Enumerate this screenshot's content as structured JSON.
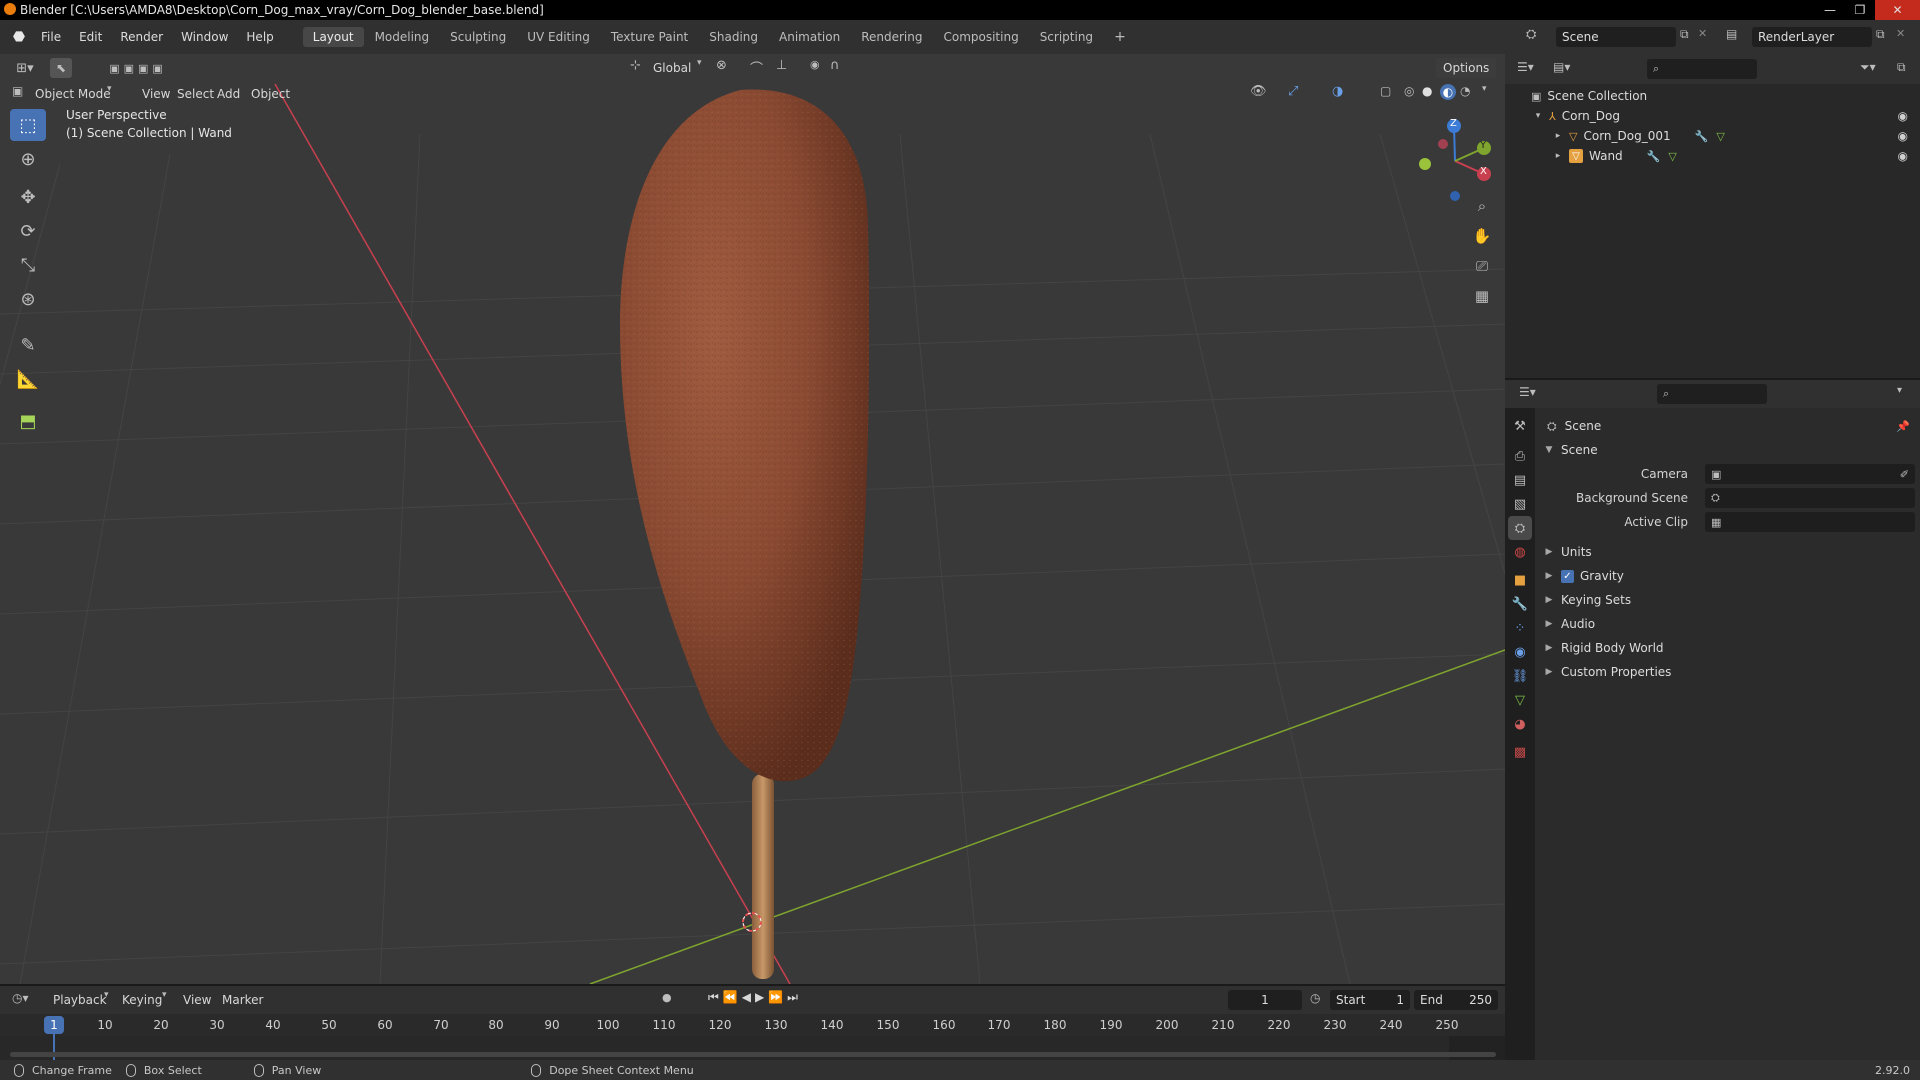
{
  "window": {
    "title": "Blender [C:\\Users\\AMDA8\\Desktop\\Corn_Dog_max_vray/Corn_Dog_blender_base.blend]",
    "controls": {
      "minimize": "—",
      "maximize": "❐",
      "close": "✕"
    }
  },
  "menu": {
    "items": [
      "File",
      "Edit",
      "Render",
      "Window",
      "Help"
    ],
    "workspaces": [
      "Layout",
      "Modeling",
      "Sculpting",
      "UV Editing",
      "Texture Paint",
      "Shading",
      "Animation",
      "Rendering",
      "Compositing",
      "Scripting"
    ],
    "active_workspace": "Layout",
    "add_workspace": "+",
    "scene": "Scene",
    "view_layer": "RenderLayer"
  },
  "viewport": {
    "mode": "Object Mode",
    "menus": [
      "View",
      "Select",
      "Add",
      "Object"
    ],
    "transform_orientation": "Global",
    "options_label": "Options",
    "overlay_title": "User Perspective",
    "overlay_subtitle": "(1) Scene Collection | Wand",
    "gizmo_labels": {
      "x": "X",
      "y": "Y",
      "z": "Z"
    },
    "tools": [
      "select-box",
      "cursor",
      "move",
      "rotate",
      "scale",
      "transform",
      "annotate",
      "measure",
      "add-cube"
    ],
    "active_tool": "select-box"
  },
  "outliner": {
    "root": "Scene Collection",
    "items": [
      {
        "label": "Corn_Dog",
        "depth": 1,
        "expanded": true
      },
      {
        "label": "Corn_Dog_001",
        "depth": 2,
        "expanded": false
      },
      {
        "label": "Wand",
        "depth": 2,
        "expanded": false
      }
    ]
  },
  "properties": {
    "context": "Scene",
    "panel_title": "Scene",
    "fields": [
      {
        "label": "Camera",
        "value": ""
      },
      {
        "label": "Background Scene",
        "value": ""
      },
      {
        "label": "Active Clip",
        "value": ""
      }
    ],
    "subpanels": [
      {
        "label": "Units",
        "checkbox": false
      },
      {
        "label": "Gravity",
        "checkbox": true,
        "checked": true
      },
      {
        "label": "Keying Sets",
        "checkbox": false
      },
      {
        "label": "Audio",
        "checkbox": false
      },
      {
        "label": "Rigid Body World",
        "checkbox": false
      },
      {
        "label": "Custom Properties",
        "checkbox": false
      }
    ]
  },
  "timeline": {
    "menus": [
      "Playback",
      "Keying",
      "View",
      "Marker"
    ],
    "current_frame": "1",
    "start_label": "Start",
    "start_value": "1",
    "end_label": "End",
    "end_value": "250",
    "ticks": [
      "1",
      "10",
      "20",
      "30",
      "40",
      "50",
      "60",
      "70",
      "80",
      "90",
      "100",
      "110",
      "120",
      "130",
      "140",
      "150",
      "160",
      "170",
      "180",
      "190",
      "200",
      "210",
      "220",
      "230",
      "240",
      "250"
    ]
  },
  "statusbar": {
    "items": [
      "Change Frame",
      "Box Select",
      "Pan View",
      "Dope Sheet Context Menu"
    ],
    "version": "2.92.0"
  },
  "colors": {
    "accent": "#4772b3",
    "x_axis": "#c8404f",
    "y_axis": "#7fa52e",
    "z_axis": "#3c7cd6",
    "batter": "#8a4a32",
    "stick": "#b8845a"
  }
}
